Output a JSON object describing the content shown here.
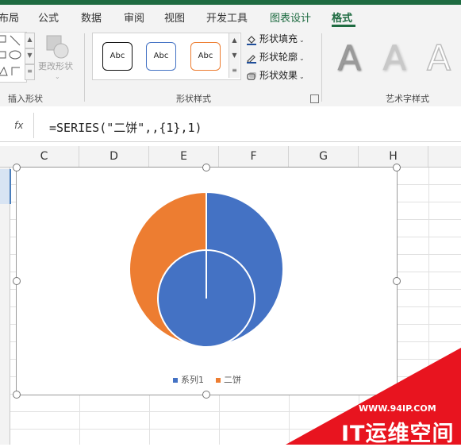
{
  "ribbon": {
    "tabs": [
      {
        "label": "布局",
        "state": "normal"
      },
      {
        "label": "公式",
        "state": "normal"
      },
      {
        "label": "数据",
        "state": "normal"
      },
      {
        "label": "审阅",
        "state": "normal"
      },
      {
        "label": "视图",
        "state": "normal"
      },
      {
        "label": "开发工具",
        "state": "normal"
      },
      {
        "label": "图表设计",
        "state": "contextual"
      },
      {
        "label": "格式",
        "state": "active"
      }
    ],
    "groups": {
      "insert_shapes": {
        "label": "插入形状",
        "edit_shape": "更改形状"
      },
      "shape_styles": {
        "label": "形状样式",
        "presets": [
          "Abc",
          "Abc",
          "Abc"
        ],
        "fill": "形状填充",
        "outline": "形状轮廓",
        "effects": "形状效果"
      },
      "wordart": {
        "label": "艺术字样式",
        "samples": [
          "A",
          "A",
          "A"
        ]
      }
    }
  },
  "formula_bar": {
    "fx_label": "fx",
    "formula": "=SERIES(\"二饼\",,{1},1)"
  },
  "columns": [
    "C",
    "D",
    "E",
    "F",
    "G",
    "H"
  ],
  "chart_data": {
    "type": "pie",
    "title": "",
    "series": [
      {
        "name": "系列1",
        "values": [
          1
        ],
        "color": "#4472c4"
      },
      {
        "name": "二饼",
        "values": [
          0.545,
          0.455
        ],
        "colors": [
          "#4472c4",
          "#ed7d31"
        ]
      }
    ],
    "legend": {
      "position": "bottom",
      "entries": [
        "系列1",
        "二饼"
      ]
    }
  },
  "colors": {
    "excel_green": "#1e6b41",
    "series_blue": "#4472c4",
    "series_orange": "#ed7d31"
  },
  "watermark": {
    "url": "WWW.94IP.COM",
    "text": "IT运维空间"
  }
}
